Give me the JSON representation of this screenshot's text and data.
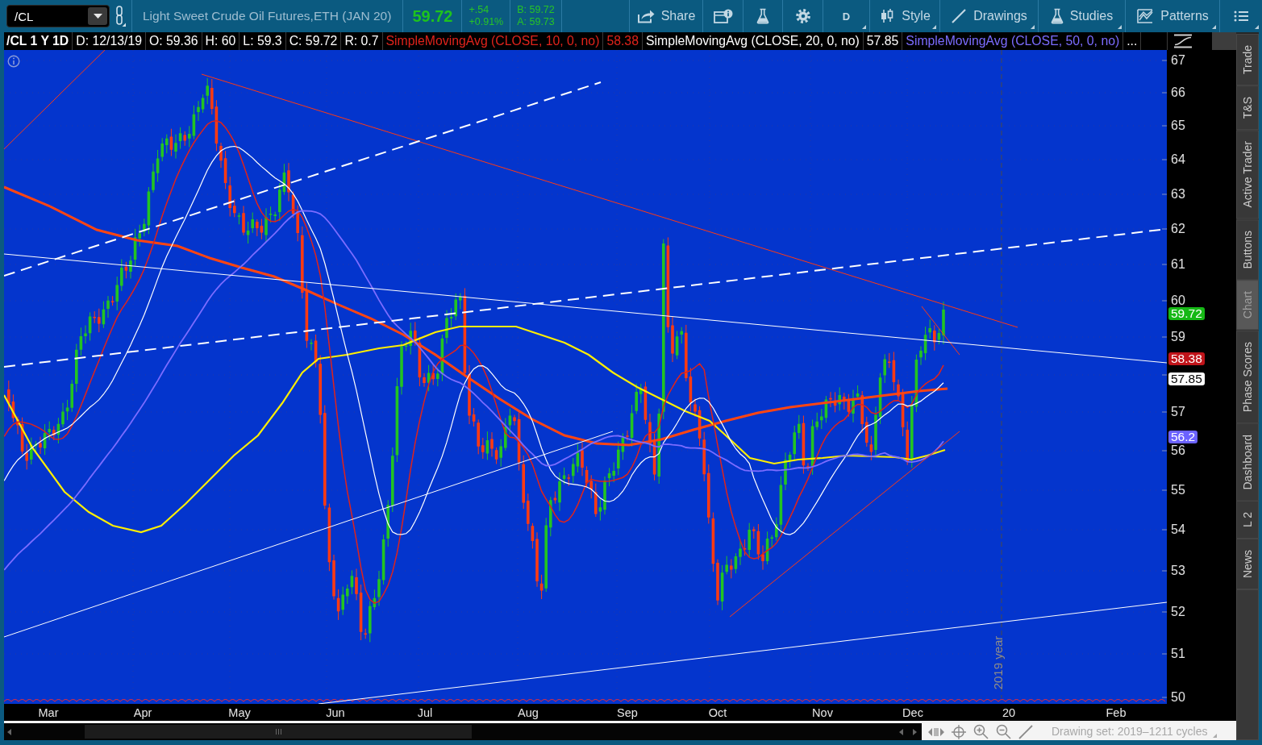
{
  "toolbar": {
    "symbol": {
      "value": "/CL"
    },
    "description": "Light Sweet Crude Oil Futures,ETH (JAN 20)",
    "last_price": "59.72",
    "net_change": "+.54",
    "percent_change": "+0.91%",
    "bid": "B: 59.72",
    "ask": "A: 59.73",
    "buttons": [
      {
        "kind": "share",
        "label": "Share",
        "menu": false
      },
      {
        "kind": "info-window",
        "menu": false
      },
      {
        "kind": "flask",
        "menu": false
      },
      {
        "kind": "gear",
        "menu": false
      },
      {
        "kind": "period",
        "label": "D",
        "menu": true
      },
      {
        "kind": "style",
        "label": "Style",
        "menu": true
      },
      {
        "kind": "drawings",
        "label": "Drawings",
        "menu": true
      },
      {
        "kind": "studies",
        "label": "Studies",
        "menu": true
      },
      {
        "kind": "patterns",
        "label": "Patterns",
        "menu": true
      },
      {
        "kind": "list",
        "menu": true
      }
    ]
  },
  "legend": {
    "symbol": "/CL 1 Y 1D",
    "fields": [
      "D: 12/13/19",
      "O: 59.36",
      "H: 60",
      "L: 59.3",
      "C: 59.72",
      "R: 0.7"
    ],
    "studies": [
      {
        "name": "SimpleMovingAvg (CLOSE, 10, 0, no)",
        "value": "58.38",
        "color": "#e0231b"
      },
      {
        "name": "SimpleMovingAvg (CLOSE, 20, 0, no)",
        "value": "57.85",
        "color": "#ffffff"
      },
      {
        "name": "SimpleMovingAvg (CLOSE, 50, 0, no)",
        "color": "#7b6cff"
      }
    ],
    "more": "..."
  },
  "chart": {
    "year_marker": "2019 year",
    "y_axis": {
      "ticks": [
        "67",
        "66",
        "65",
        "64",
        "63",
        "62",
        "61",
        "60",
        "59",
        "57",
        "56",
        "55",
        "54",
        "53",
        "52",
        "51",
        "50"
      ],
      "price_labels": [
        {
          "value": "59.72",
          "color": "#16b816"
        },
        {
          "value": "58.38",
          "color": "#c0141a"
        },
        {
          "value": "57.85",
          "color": "#ffffff"
        },
        {
          "value": "56.2",
          "color": "#6b62ff"
        }
      ]
    },
    "x_axis": {
      "labels": [
        "Mar",
        "Apr",
        "May",
        "Jun",
        "Jul",
        "Aug",
        "Sep",
        "Oct",
        "Nov",
        "Dec",
        "20",
        "Feb"
      ]
    }
  },
  "side_tabs": [
    {
      "label": "Trade",
      "selected": false
    },
    {
      "label": "T&S",
      "selected": false
    },
    {
      "label": "Active Trader",
      "selected": false
    },
    {
      "label": "Buttons",
      "selected": false
    },
    {
      "label": "Chart",
      "selected": true
    },
    {
      "label": "Phase Scores",
      "selected": false
    },
    {
      "label": "Dashboard",
      "selected": false
    },
    {
      "label": "L 2",
      "selected": false
    },
    {
      "label": "News",
      "selected": false
    }
  ],
  "bottom_bar": {
    "drawing_set": "Drawing set: 2019–1211 cycles"
  }
}
